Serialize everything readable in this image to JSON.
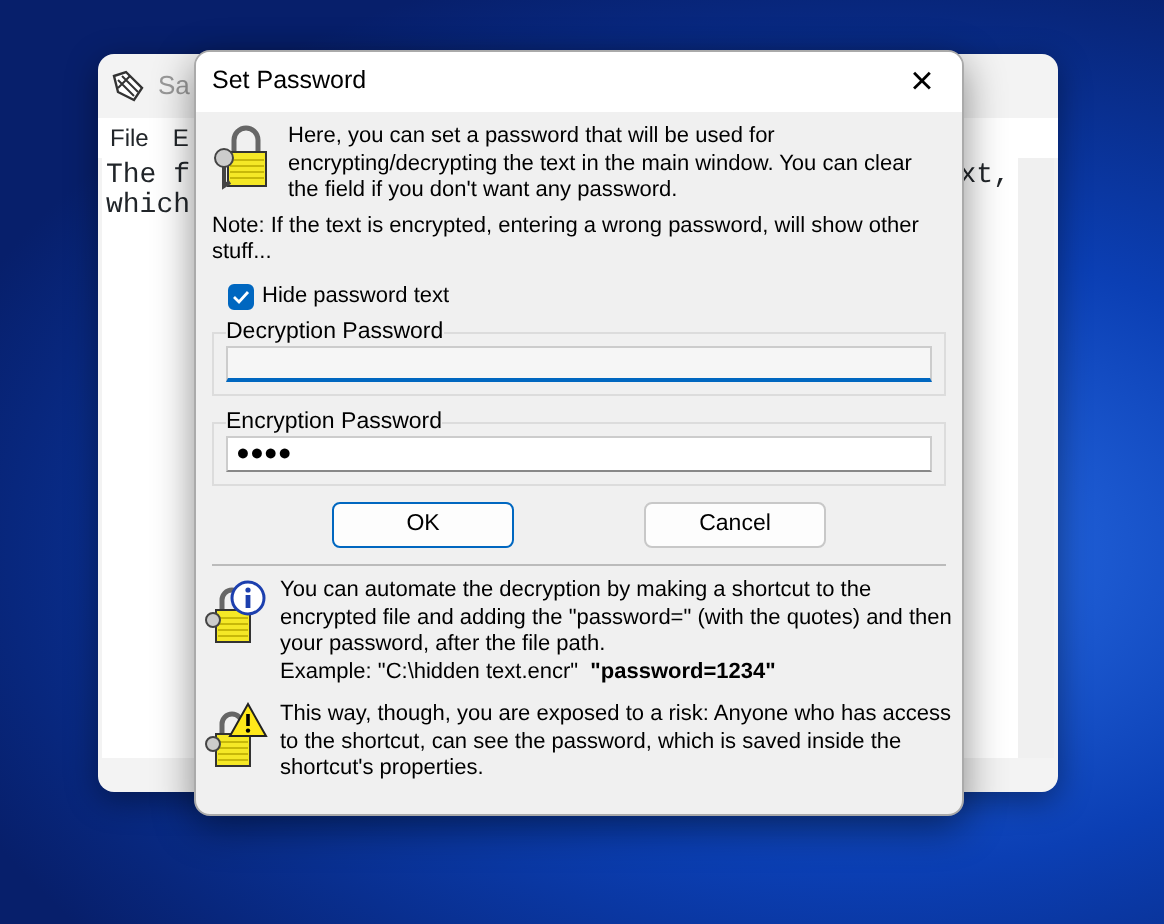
{
  "background_window": {
    "title": "Sa",
    "menu": [
      "File",
      "E"
    ],
    "text_lines": [
      {
        "left": "The f",
        "right": "xt,"
      },
      {
        "left": "which"
      }
    ]
  },
  "dialog": {
    "title": "Set Password",
    "close": "×",
    "intro": "Here, you can set a password that will be used for encrypting/decrypting the text in the main window. You can clear the field if you don't want any password.",
    "note": "Note: If the text is encrypted, entering a wrong password, will show other stuff...",
    "hide_password": {
      "label": "Hide password text",
      "checked": true
    },
    "fields": [
      {
        "legend": "Decryption Password",
        "focused": true
      },
      {
        "legend": "Encryption Password",
        "value": "●●●●",
        "focused": false
      }
    ],
    "buttons": [
      {
        "label": "OK",
        "default": true
      },
      {
        "label": "Cancel",
        "default": false
      }
    ],
    "tips": [
      {
        "kind": "info",
        "text": "You can automate the decryption by making a shortcut to the encrypted file and adding the \"password=\" (with the quotes) and then your password, after the file path.",
        "example": "Example: \"C:\\hidden text.encr\"  **\"password=1234\"**"
      },
      {
        "kind": "warning",
        "text": "This way, though, you are exposed to a risk: Anyone who has access to the shortcut, can see the password, which is saved inside the shortcut's properties."
      }
    ]
  }
}
